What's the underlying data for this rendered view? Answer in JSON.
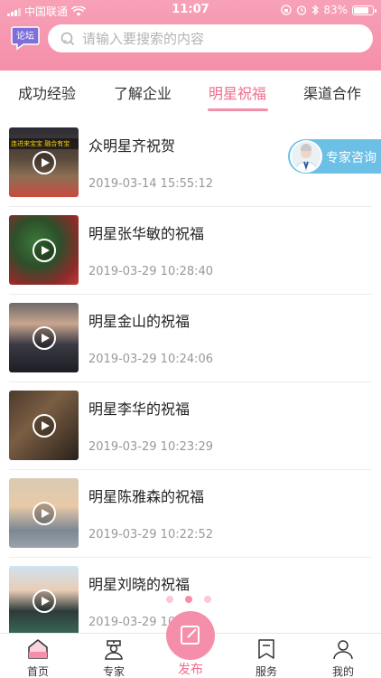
{
  "status_bar": {
    "carrier": "中国联通",
    "time": "11:07",
    "battery_percent": "83%",
    "battery_level": 0.83
  },
  "header": {
    "forum_badge": "论坛",
    "search_placeholder": "请输入要搜索的内容"
  },
  "tabs": [
    {
      "label": "成功经验",
      "active": false
    },
    {
      "label": "了解企业",
      "active": false
    },
    {
      "label": "明星祝福",
      "active": true
    },
    {
      "label": "渠道合作",
      "active": false
    }
  ],
  "articles": [
    {
      "title": "众明星齐祝贺",
      "date": "2019-03-14 15:55:12",
      "thumb_banner": "连进来宝宝  融合有宝"
    },
    {
      "title": "明星张华敏的祝福",
      "date": "2019-03-29 10:28:40"
    },
    {
      "title": "明星金山的祝福",
      "date": "2019-03-29 10:24:06"
    },
    {
      "title": "明星李华的祝福",
      "date": "2019-03-29 10:23:29"
    },
    {
      "title": "明星陈雅森的祝福",
      "date": "2019-03-29 10:22:52"
    },
    {
      "title": "明星刘晓的祝福",
      "date": "2019-03-29 10"
    }
  ],
  "consult_button": {
    "label": "专家咨询"
  },
  "pager": {
    "count": 3,
    "active_index": 1
  },
  "bottom_nav": {
    "home": "首页",
    "expert": "专家",
    "publish": "发布",
    "service": "服务",
    "mine": "我的"
  },
  "colors": {
    "brand_pink": "#f58fa9",
    "active_text": "#f06d8d",
    "consult_blue": "#6cc0e6"
  }
}
